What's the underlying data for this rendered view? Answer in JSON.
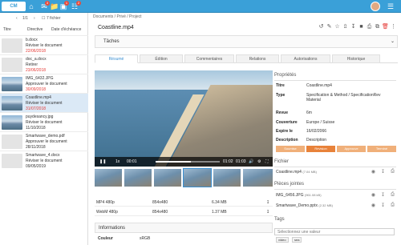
{
  "topbar": {
    "logo": "CM",
    "icons": [
      "home-icon",
      "mail-icon",
      "folder-icon",
      "camera-icon",
      "cart-icon",
      "user-icon",
      "list-icon"
    ],
    "badges": [
      "3",
      "1",
      "2"
    ],
    "colors": {
      "bar": "#3aa0d8",
      "accent": "#3a8fd1",
      "danger": "#e74c3c"
    }
  },
  "left": {
    "pager": "1/1",
    "page_count": "7 fichier",
    "columns": [
      "Titre",
      "Directive",
      "Date d'échéance"
    ],
    "items": [
      {
        "name": "b.docx",
        "task": "Réviser le document",
        "date": "22/06/2018",
        "overdue": true,
        "type": "doc"
      },
      {
        "name": "doc_a.docx",
        "task": "Retirer",
        "date": "23/06/2018",
        "overdue": true,
        "type": "doc"
      },
      {
        "name": "IMG_6432.JPG",
        "task": "Approuver le document",
        "date": "30/09/2018",
        "overdue": true,
        "type": "img"
      },
      {
        "name": "Coastline.mp4",
        "task": "Réviser le document",
        "date": "31/07/2018",
        "overdue": true,
        "type": "img"
      },
      {
        "name": "puydesancy.jpg",
        "task": "Réviser le document",
        "date": "11/10/2018",
        "overdue": false,
        "type": "img"
      },
      {
        "name": "Smartwave_demo.pdf",
        "task": "Approuver le document",
        "date": "28/11/2018",
        "overdue": false,
        "type": "doc"
      },
      {
        "name": "Smartwave_4.docx",
        "task": "Réviser le document",
        "date": "09/05/2019",
        "overdue": false,
        "type": "doc"
      }
    ]
  },
  "main": {
    "breadcrumb": "Documents / Privé / Project",
    "title": "Coastline.mp4",
    "taches": "Tâches",
    "tabs": [
      "Résumé",
      "Édition",
      "Commentaires",
      "Relations",
      "Autorisations",
      "Historique"
    ],
    "video": {
      "time_current": "00:01",
      "time_mid": "01:02",
      "time_total": "01:03",
      "speed": "1x",
      "progress": 0.55
    },
    "formats": [
      {
        "name": "MP4 480p",
        "res": "854x480",
        "size": "6.34 MB"
      },
      {
        "name": "WebM 480p",
        "res": "854x480",
        "size": "1.37 MB"
      }
    ],
    "informations": {
      "title": "Informations",
      "label": "Couleur",
      "value": "sRGB"
    }
  },
  "right": {
    "proprietes": "Propriétés",
    "props": [
      {
        "label": "Titre",
        "value": "Coastline.mp4"
      },
      {
        "label": "Type",
        "value": "Specification & Method / SpecificationRev Material"
      },
      {
        "label": "Revue",
        "value": "6m"
      },
      {
        "label": "Couverture",
        "value": "Europe / Suisse"
      },
      {
        "label": "Expire le",
        "value": "16/02/2066"
      },
      {
        "label": "Description",
        "value": "Description"
      }
    ],
    "steps": [
      {
        "label": "Soumise",
        "color": "#f0b07a"
      },
      {
        "label": "Révision",
        "color": "#e8823a"
      },
      {
        "label": "Approuve",
        "color": "#f0b07a"
      },
      {
        "label": "Terminé",
        "color": "#f0b07a"
      }
    ],
    "fichier": "Fichier",
    "file": {
      "name": "Coastline.mp4",
      "size": "(7.04 MB)"
    },
    "pieces": "Pièces jointes",
    "attachments": [
      {
        "name": "IMG_6456.JPG",
        "size": "(961.08 kB)"
      },
      {
        "name": "Smartwave_Demo.pptx",
        "size": "(2.32 MB)"
      }
    ],
    "tags_title": "Tags",
    "tags_placeholder": "Sélectionnez une valeur",
    "tags": [
      "video",
      "sea"
    ]
  }
}
